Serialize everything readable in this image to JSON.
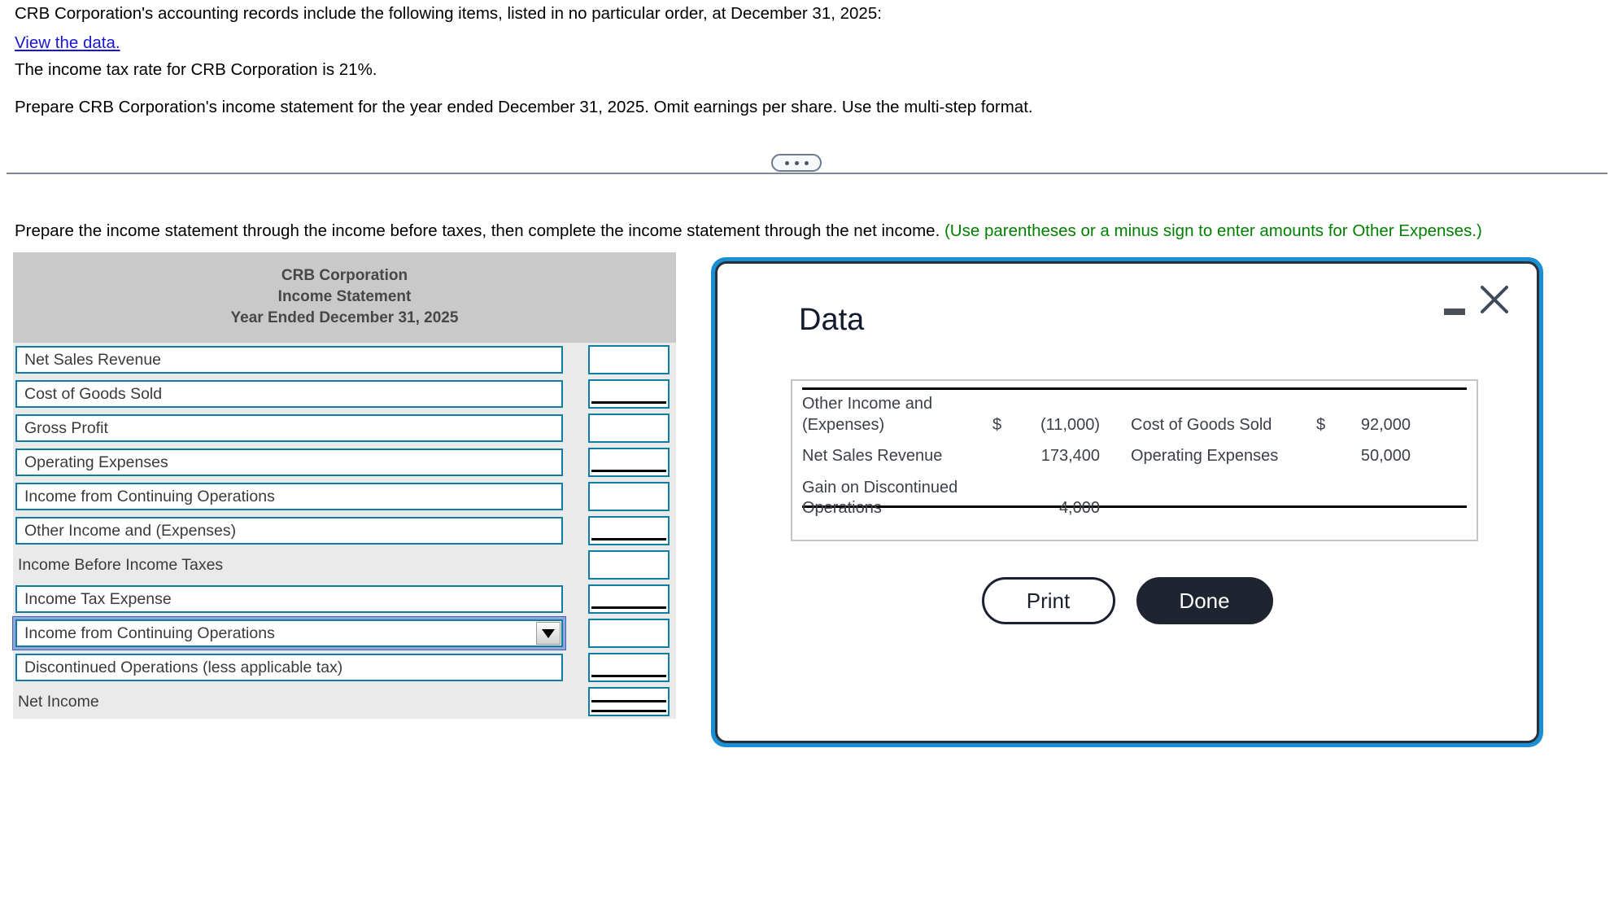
{
  "prompt": {
    "line1": "CRB Corporation's accounting records include the following items, listed in no particular order, at December 31, 2025:",
    "view_data_link": "View the data.",
    "line3": "The income tax rate for CRB Corporation is 21%.",
    "line4": "Prepare CRB Corporation's income statement for the year ended December 31, 2025. Omit earnings per share. Use the multi-step format."
  },
  "instruction": {
    "black": "Prepare the income statement through the income before taxes, then complete the income statement through the net income. ",
    "green": "(Use parentheses or a minus sign to enter amounts for Other Expenses.)"
  },
  "statement": {
    "header": {
      "company": "CRB Corporation",
      "title": "Income Statement",
      "period": "Year Ended December 31, 2025"
    },
    "rows": [
      {
        "label": "Net Sales Revenue",
        "value": "",
        "type": "input",
        "underline": "none"
      },
      {
        "label": "Cost of Goods Sold",
        "value": "",
        "type": "input",
        "underline": "single"
      },
      {
        "label": "Gross Profit",
        "value": "",
        "type": "input",
        "underline": "none"
      },
      {
        "label": "Operating Expenses",
        "value": "",
        "type": "input",
        "underline": "single"
      },
      {
        "label": "Income from Continuing Operations",
        "value": "",
        "type": "input",
        "underline": "none"
      },
      {
        "label": "Other Income and (Expenses)",
        "value": "",
        "type": "input",
        "underline": "single"
      },
      {
        "label": "Income Before Income Taxes",
        "value": "",
        "type": "static",
        "underline": "none"
      },
      {
        "label": "Income Tax Expense",
        "value": "",
        "type": "input",
        "underline": "single"
      },
      {
        "label": "Income from Continuing Operations",
        "value": "",
        "type": "select",
        "underline": "none"
      },
      {
        "label": "Discontinued Operations (less applicable tax)",
        "value": "",
        "type": "input",
        "underline": "single"
      },
      {
        "label": "Net Income",
        "value": "",
        "type": "static",
        "underline": "double"
      }
    ]
  },
  "modal": {
    "title": "Data",
    "minimize_icon": "minimize-icon",
    "close_icon": "close-icon",
    "print_label": "Print",
    "done_label": "Done",
    "table": {
      "rows": [
        {
          "left_label_a": "Other Income and",
          "left_label_b": "(Expenses)",
          "left_dollar": "$",
          "left_amount": "(11,000)",
          "right_label_a": "Cost of Goods Sold",
          "right_label_b": "",
          "right_dollar": "$",
          "right_amount": "92,000"
        },
        {
          "left_label_a": "Net Sales Revenue",
          "left_label_b": "",
          "left_dollar": "",
          "left_amount": "173,400",
          "right_label_a": "Operating Expenses",
          "right_label_b": "",
          "right_dollar": "",
          "right_amount": "50,000"
        },
        {
          "left_label_a": "Gain on Discontinued",
          "left_label_b": "Operations",
          "left_dollar": "",
          "left_amount": "4,000",
          "right_label_a": "",
          "right_label_b": "",
          "right_dollar": "",
          "right_amount": ""
        }
      ]
    }
  },
  "colors": {
    "link": "#1915d4",
    "green_note": "#008000",
    "input_border": "#0f7da1",
    "header_bg": "#c9c9c9",
    "row_bg": "#eaeaea",
    "modal_ring": "#1a8fd4",
    "done_bg": "#1e2430"
  }
}
